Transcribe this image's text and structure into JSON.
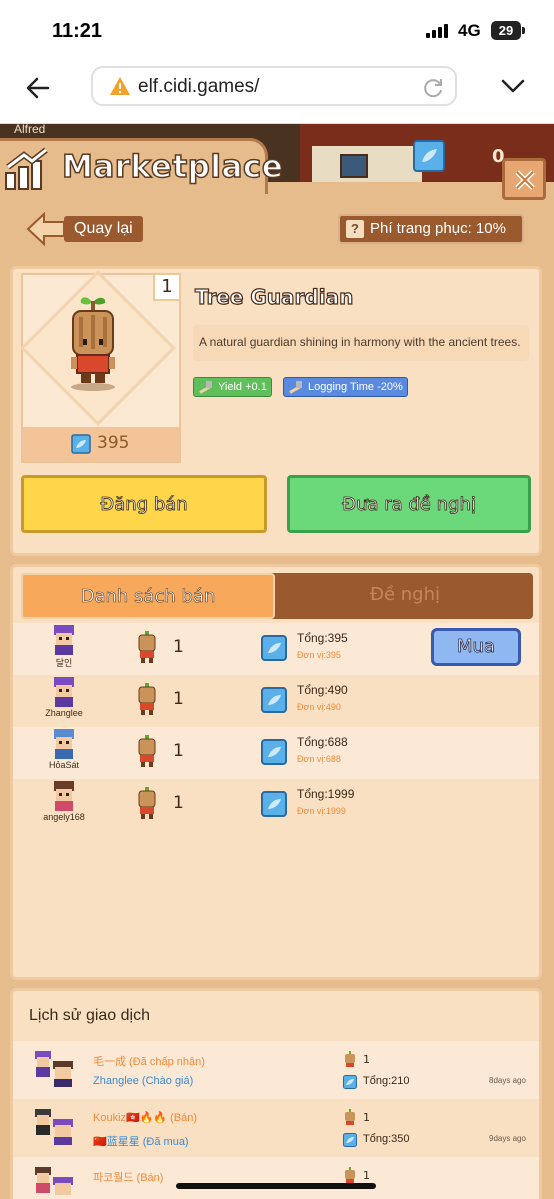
{
  "status": {
    "time": "11:21",
    "network": "4G",
    "battery": "29"
  },
  "browser": {
    "url": "elf.cidi.games/"
  },
  "scene": {
    "nameplate": "Alfred",
    "counter": "0"
  },
  "header": {
    "title": "Marketplace"
  },
  "toolbar": {
    "back_label": "Quay lại",
    "fee_label": "Phí trang phục: 10%",
    "fee_icon": "?"
  },
  "item": {
    "quantity": "1",
    "price": "395",
    "name": "Tree Guardian",
    "description": "A natural guardian shining in harmony with the ancient trees.",
    "tags": [
      "Yield +0.1",
      "Logging Time -20%"
    ],
    "sell_label": "Đăng bán",
    "offer_label": "Đưa ra đề nghị"
  },
  "list": {
    "tabs": [
      "Danh sách bán",
      "Đề nghị"
    ],
    "buy_label": "Mua",
    "rows": [
      {
        "user": "달인",
        "qty": "1",
        "total": "Tổng:395",
        "unit": "Đơn vị:395"
      },
      {
        "user": "Zhanglee",
        "qty": "1",
        "total": "Tổng:490",
        "unit": "Đơn vị:490"
      },
      {
        "user": "HỏaSát",
        "qty": "1",
        "total": "Tổng:688",
        "unit": "Đơn vị:688"
      },
      {
        "user": "angely168",
        "qty": "1",
        "total": "Tổng:1999",
        "unit": "Đơn vị:1999"
      }
    ]
  },
  "history": {
    "title": "Lịch sử giao dịch",
    "rows": [
      {
        "line1": "毛一成 (Đã chấp nhận)",
        "line2": "Zhanglee (Chào giá)",
        "qty": "1",
        "total": "Tổng:210",
        "ago": "8days ago"
      },
      {
        "line1": "Koukiz🇭🇰🔥🔥 (Bán)",
        "line2": "🇨🇳蓝星星 (Đã mua)",
        "qty": "1",
        "total": "Tổng:350",
        "ago": "9days ago"
      },
      {
        "line1": "파코월드 (Bán)",
        "line2": "",
        "qty": "1",
        "total": "",
        "ago": ""
      }
    ]
  },
  "colors": {
    "panel_bg": "#fae0c2",
    "game_bg": "#e7bc8c",
    "sell": "#ffd54a",
    "offer": "#6bd97a",
    "buy": "#8fb8f3",
    "orange_text": "#f28a3a",
    "blue_text": "#3a8ad0"
  },
  "icons": [
    "back-arrow-icon",
    "warning-icon",
    "reload-icon",
    "chevron-down-icon",
    "chart-icon",
    "close-icon",
    "gem-icon",
    "tree-guardian-sprite",
    "avatar-icon"
  ]
}
